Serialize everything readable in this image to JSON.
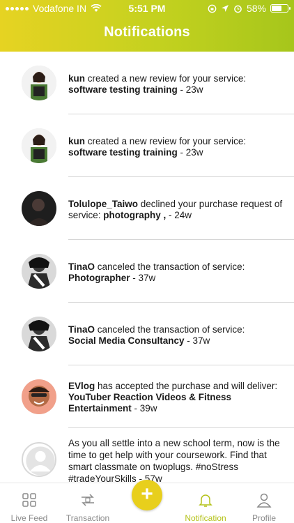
{
  "status_bar": {
    "carrier": "Vodafone IN",
    "time": "5:51 PM",
    "battery": "58%"
  },
  "header": {
    "title": "Notifications"
  },
  "notifications": [
    {
      "user": "kun",
      "text": " created a new review for your service:",
      "target": "software testing training",
      "time": " - 23w"
    },
    {
      "user": "kun",
      "text": " created a new review for your service:",
      "target": "software testing training",
      "time": " - 23w"
    },
    {
      "user": "Tolulope_Taiwo",
      "text": " declined your purchase request of service: ",
      "target": "photography ,",
      "time": " - 24w"
    },
    {
      "user": "TinaO",
      "text": " canceled the transaction of service:",
      "target": "Photographer",
      "time": "  - 37w"
    },
    {
      "user": "TinaO",
      "text": " canceled the transaction of service:",
      "target": "Social Media Consultancy",
      "time": "  - 37w"
    },
    {
      "user": "EVlog",
      "text": " has accepted the purchase and will deliver: ",
      "target": "YouTuber Reaction Videos & Fitness Entertainment",
      "time": "  - 39w"
    },
    {
      "user": "",
      "text": "As you all settle into a new school term, now is the time to get help with your coursework. Find that smart classmate on twoplugs. #noStress #tradeYourSkills - 57w",
      "target": "",
      "time": ""
    }
  ],
  "tabbar": {
    "live_feed": "Live Feed",
    "transaction": "Transaction",
    "notification": "Notification",
    "profile": "Profile"
  },
  "colors": {
    "header_start": "#e6d322",
    "header_end": "#a6c61b",
    "accent": "#b4c21a",
    "fab": "#e8cf1c"
  }
}
